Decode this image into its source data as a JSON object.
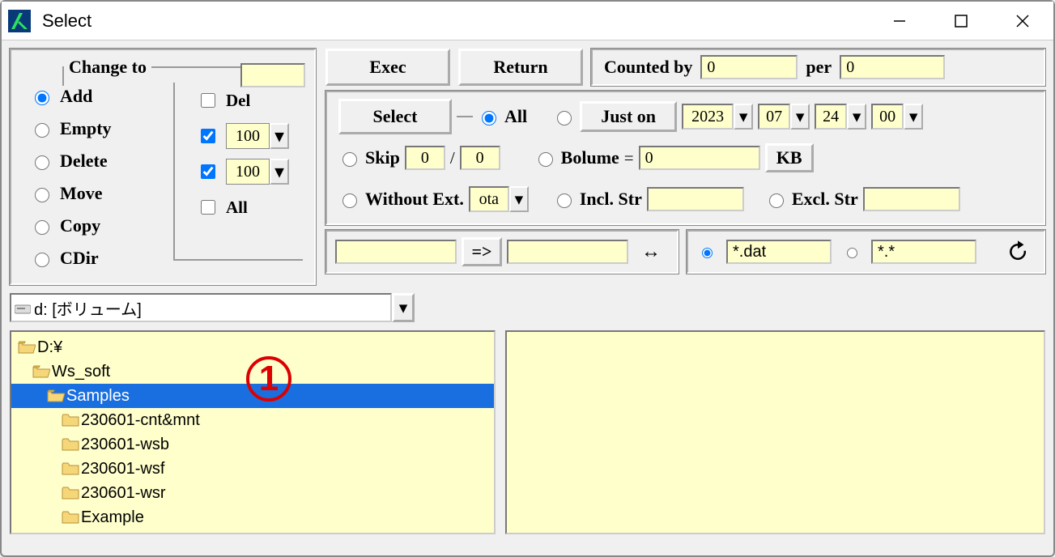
{
  "window": {
    "title": "Select"
  },
  "change": {
    "legend": "Change to",
    "fieldValue": "",
    "radios": [
      "Add",
      "Empty",
      "Delete",
      "Move",
      "Copy",
      "CDir"
    ],
    "selectedRadio": 0,
    "delLabel": "Del",
    "delChecked": false,
    "cb1Checked": true,
    "cb1Value": "100",
    "cb2Checked": true,
    "cb2Value": "100",
    "allLabel": "All",
    "allChecked": false
  },
  "buttons": {
    "exec": "Exec",
    "return": "Return",
    "select": "Select"
  },
  "counted": {
    "label": "Counted by",
    "v1": "0",
    "perLabel": "per",
    "v2": "0"
  },
  "options": {
    "allLabel": "All",
    "justOnLabel": "Just on",
    "year": "2023",
    "month": "07",
    "day": "24",
    "hour": "00",
    "skipLabel": "Skip",
    "skip1": "0",
    "skip2": "0",
    "bolumeLabel": "Bolume",
    "bolumeEq": "=",
    "bolumeVal": "0",
    "kbLabel": "KB",
    "woExtLabel": "Without Ext.",
    "woExtVal": "ota",
    "inclLabel": "Incl. Str",
    "inclVal": "",
    "exclLabel": "Excl. Str",
    "exclVal": ""
  },
  "eq": {
    "src": "",
    "arrow": "=>",
    "dst": "",
    "swap": "↔"
  },
  "filter": {
    "v1": "*.dat",
    "v2": "*.*"
  },
  "refreshGlyph": "↻",
  "drive": {
    "value": "d: [ボリューム]"
  },
  "tree": {
    "annotation": "1",
    "items": [
      {
        "indent": 0,
        "label": "D:¥",
        "open": true
      },
      {
        "indent": 1,
        "label": "Ws_soft",
        "open": true
      },
      {
        "indent": 2,
        "label": "Samples",
        "open": true,
        "selected": true
      },
      {
        "indent": 3,
        "label": "230601-cnt&mnt"
      },
      {
        "indent": 3,
        "label": "230601-wsb"
      },
      {
        "indent": 3,
        "label": "230601-wsf"
      },
      {
        "indent": 3,
        "label": "230601-wsr"
      },
      {
        "indent": 3,
        "label": "Example"
      }
    ]
  }
}
